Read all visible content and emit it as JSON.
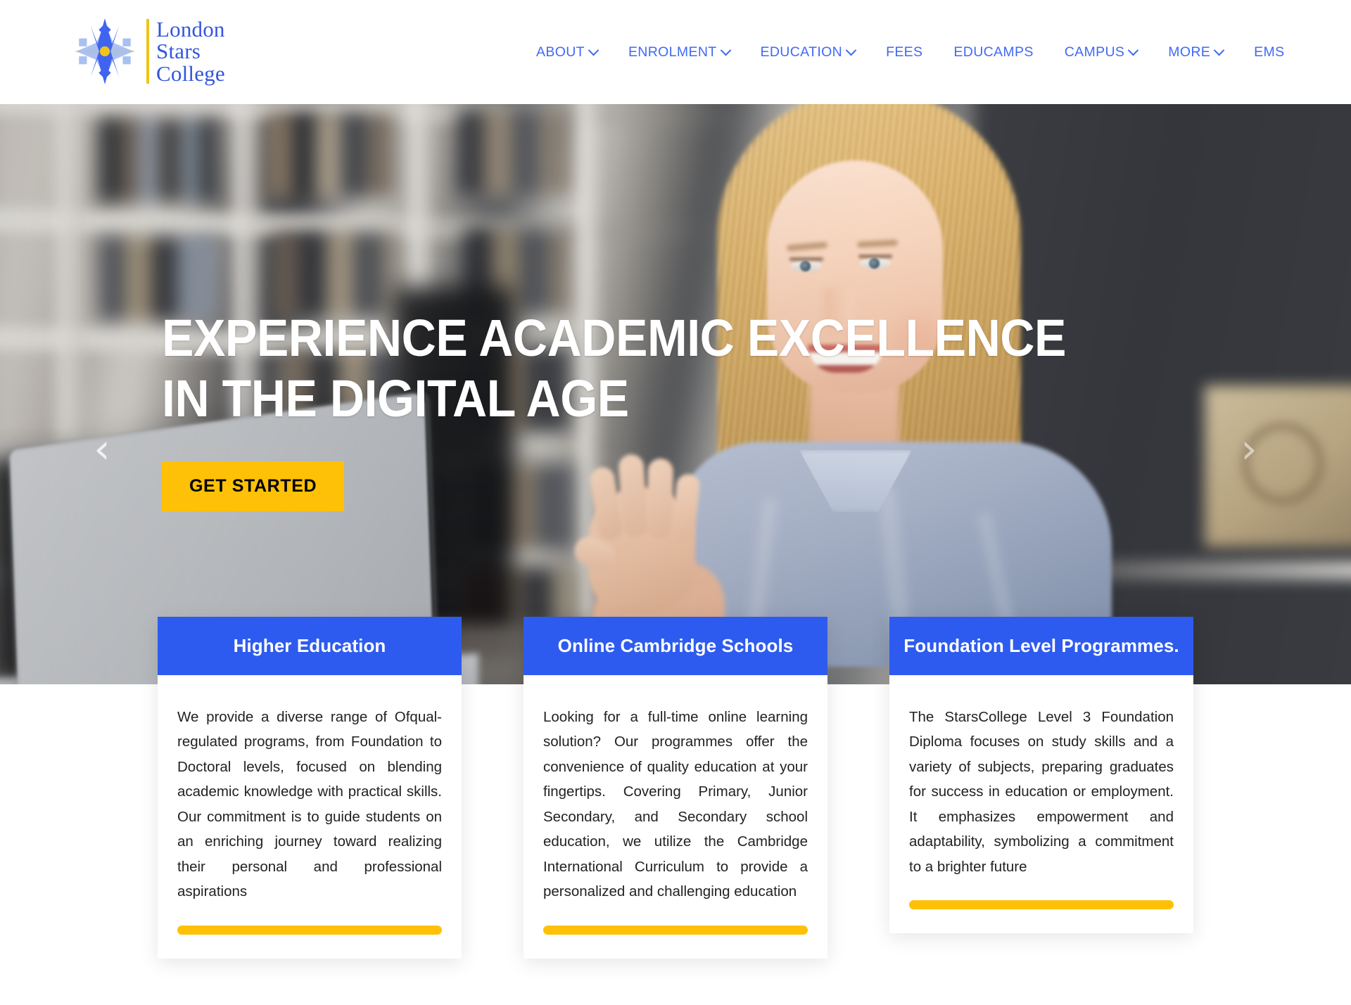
{
  "header": {
    "logo": {
      "icon": "eight-point-star-icon",
      "line1": "London",
      "line2": "Stars",
      "line3": "College"
    },
    "nav": [
      {
        "label": "ABOUT",
        "has_dropdown": true
      },
      {
        "label": "ENROLMENT",
        "has_dropdown": true
      },
      {
        "label": "EDUCATION",
        "has_dropdown": true
      },
      {
        "label": "FEES",
        "has_dropdown": false
      },
      {
        "label": "EDUCAMPS",
        "has_dropdown": false
      },
      {
        "label": "CAMPUS",
        "has_dropdown": true
      },
      {
        "label": "MORE",
        "has_dropdown": true
      },
      {
        "label": "EMS",
        "has_dropdown": false
      }
    ]
  },
  "hero": {
    "title": "EXPERIENCE ACADEMIC EXCELLENCE\nIN THE DIGITAL AGE",
    "cta_label": "GET STARTED",
    "prev_arrow": "‹",
    "next_arrow": "›"
  },
  "cards": [
    {
      "title": "Higher Education",
      "text": "We provide a diverse range of Ofqual-regulated programs, from Foundation to Doctoral levels, focused on blending academic knowledge with practical skills. Our commitment is to guide students on an enriching journey toward realizing their personal and professional aspirations"
    },
    {
      "title": "Online Cambridge Schools",
      "text": "Looking for a full-time online learning solution? Our programmes offer the convenience of quality education at your fingertips. Covering Primary, Junior Secondary, and Secondary school education, we utilize the Cambridge International Curriculum to provide a personalized and challenging education"
    },
    {
      "title": "Foundation Level Programmes.",
      "text": "The StarsCollege Level 3 Foundation Diploma focuses on study skills and a variety of subjects, preparing graduates for success in education or employment. It emphasizes empowerment and adaptability, symbolizing a commitment to a brighter future"
    }
  ],
  "colors": {
    "nav_link": "#4169f5",
    "card_header_blue": "#2e5bef",
    "accent_yellow": "#ffc107",
    "logo_blue": "#3355dd",
    "logo_gold": "#f0c419"
  }
}
